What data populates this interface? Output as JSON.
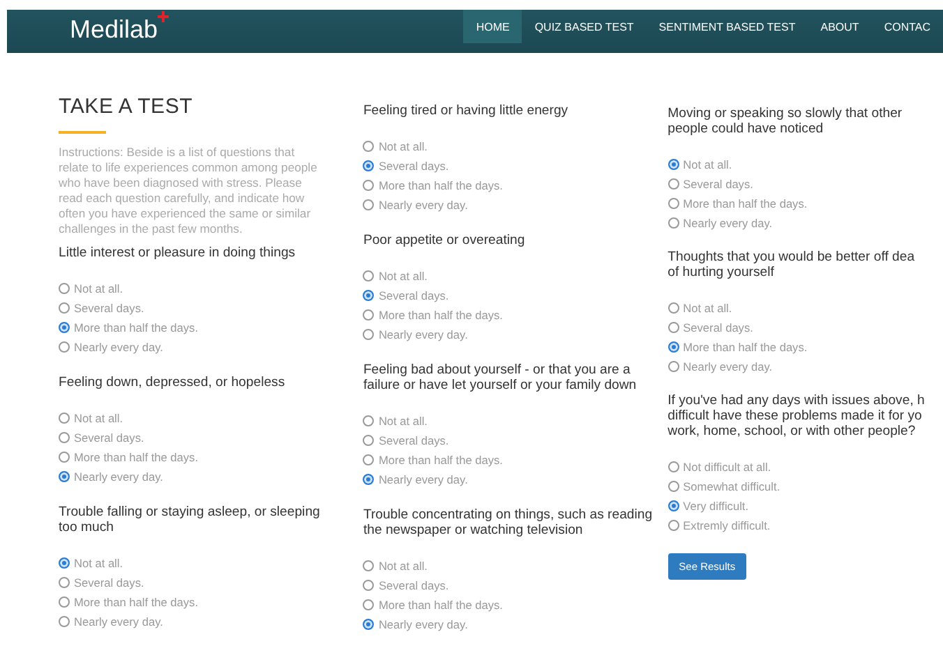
{
  "nav": {
    "logo": "Medilab",
    "items": [
      {
        "label": "HOME",
        "selected": true
      },
      {
        "label": "QUIZ BASED TEST",
        "selected": false
      },
      {
        "label": "SENTIMENT BASED TEST",
        "selected": false
      },
      {
        "label": "ABOUT",
        "selected": false
      },
      {
        "label": "CONTAC",
        "selected": false
      }
    ]
  },
  "title": "TAKE A TEST",
  "instructions": "Instructions: Beside is a list of questions that relate to life experiences common among people who have been diagnosed with stress. Please read each question carefully, and indicate how often you have experienced the same or similar challenges in the past few months.",
  "columns": [
    {
      "questions": [
        {
          "text": "Little interest or pleasure in doing things",
          "options": [
            {
              "label": "Not at all.",
              "selected": false
            },
            {
              "label": "Several days.",
              "selected": false
            },
            {
              "label": "More than half the days.",
              "selected": true
            },
            {
              "label": "Nearly every day.",
              "selected": false
            }
          ]
        },
        {
          "text": "Feeling down, depressed, or hopeless",
          "options": [
            {
              "label": "Not at all.",
              "selected": false
            },
            {
              "label": "Several days.",
              "selected": false
            },
            {
              "label": "More than half the days.",
              "selected": false
            },
            {
              "label": "Nearly every day.",
              "selected": true
            }
          ]
        },
        {
          "text": "Trouble falling or staying asleep, or sleeping too much",
          "options": [
            {
              "label": "Not at all.",
              "selected": true
            },
            {
              "label": "Several days.",
              "selected": false
            },
            {
              "label": "More than half the days.",
              "selected": false
            },
            {
              "label": "Nearly every day.",
              "selected": false
            }
          ]
        }
      ]
    },
    {
      "questions": [
        {
          "text": "Feeling tired or having little energy",
          "options": [
            {
              "label": "Not at all.",
              "selected": false
            },
            {
              "label": "Several days.",
              "selected": true
            },
            {
              "label": "More than half the days.",
              "selected": false
            },
            {
              "label": "Nearly every day.",
              "selected": false
            }
          ]
        },
        {
          "text": "Poor appetite or overeating",
          "options": [
            {
              "label": "Not at all.",
              "selected": false
            },
            {
              "label": "Several days.",
              "selected": true
            },
            {
              "label": "More than half the days.",
              "selected": false
            },
            {
              "label": "Nearly every day.",
              "selected": false
            }
          ]
        },
        {
          "text": "Feeling bad about yourself - or that you are a failure or have let yourself or your family down",
          "options": [
            {
              "label": "Not at all.",
              "selected": false
            },
            {
              "label": "Several days.",
              "selected": false
            },
            {
              "label": "More than half the days.",
              "selected": false
            },
            {
              "label": "Nearly every day.",
              "selected": true
            }
          ]
        },
        {
          "text": "Trouble concentrating on things, such as reading the newspaper or watching television",
          "options": [
            {
              "label": "Not at all.",
              "selected": false
            },
            {
              "label": "Several days.",
              "selected": false
            },
            {
              "label": "More than half the days.",
              "selected": false
            },
            {
              "label": "Nearly every day.",
              "selected": true
            }
          ]
        }
      ]
    },
    {
      "questions": [
        {
          "text": "Moving or speaking so slowly that other people could have noticed",
          "options": [
            {
              "label": "Not at all.",
              "selected": true
            },
            {
              "label": "Several days.",
              "selected": false
            },
            {
              "label": "More than half the days.",
              "selected": false
            },
            {
              "label": "Nearly every day.",
              "selected": false
            }
          ]
        },
        {
          "text": "Thoughts that you would be better off dea\nof hurting yourself",
          "options": [
            {
              "label": "Not at all.",
              "selected": false
            },
            {
              "label": "Several days.",
              "selected": false
            },
            {
              "label": "More than half the days.",
              "selected": true
            },
            {
              "label": "Nearly every day.",
              "selected": false
            }
          ]
        },
        {
          "text": "If you've had any days with issues above, h\ndifficult have these problems made it for yo\nwork, home, school, or with other people?",
          "options": [
            {
              "label": "Not difficult at all.",
              "selected": false
            },
            {
              "label": "Somewhat difficult.",
              "selected": false
            },
            {
              "label": "Very difficult.",
              "selected": true
            },
            {
              "label": "Extremly difficult.",
              "selected": false
            }
          ]
        }
      ],
      "button": "See Results"
    }
  ]
}
